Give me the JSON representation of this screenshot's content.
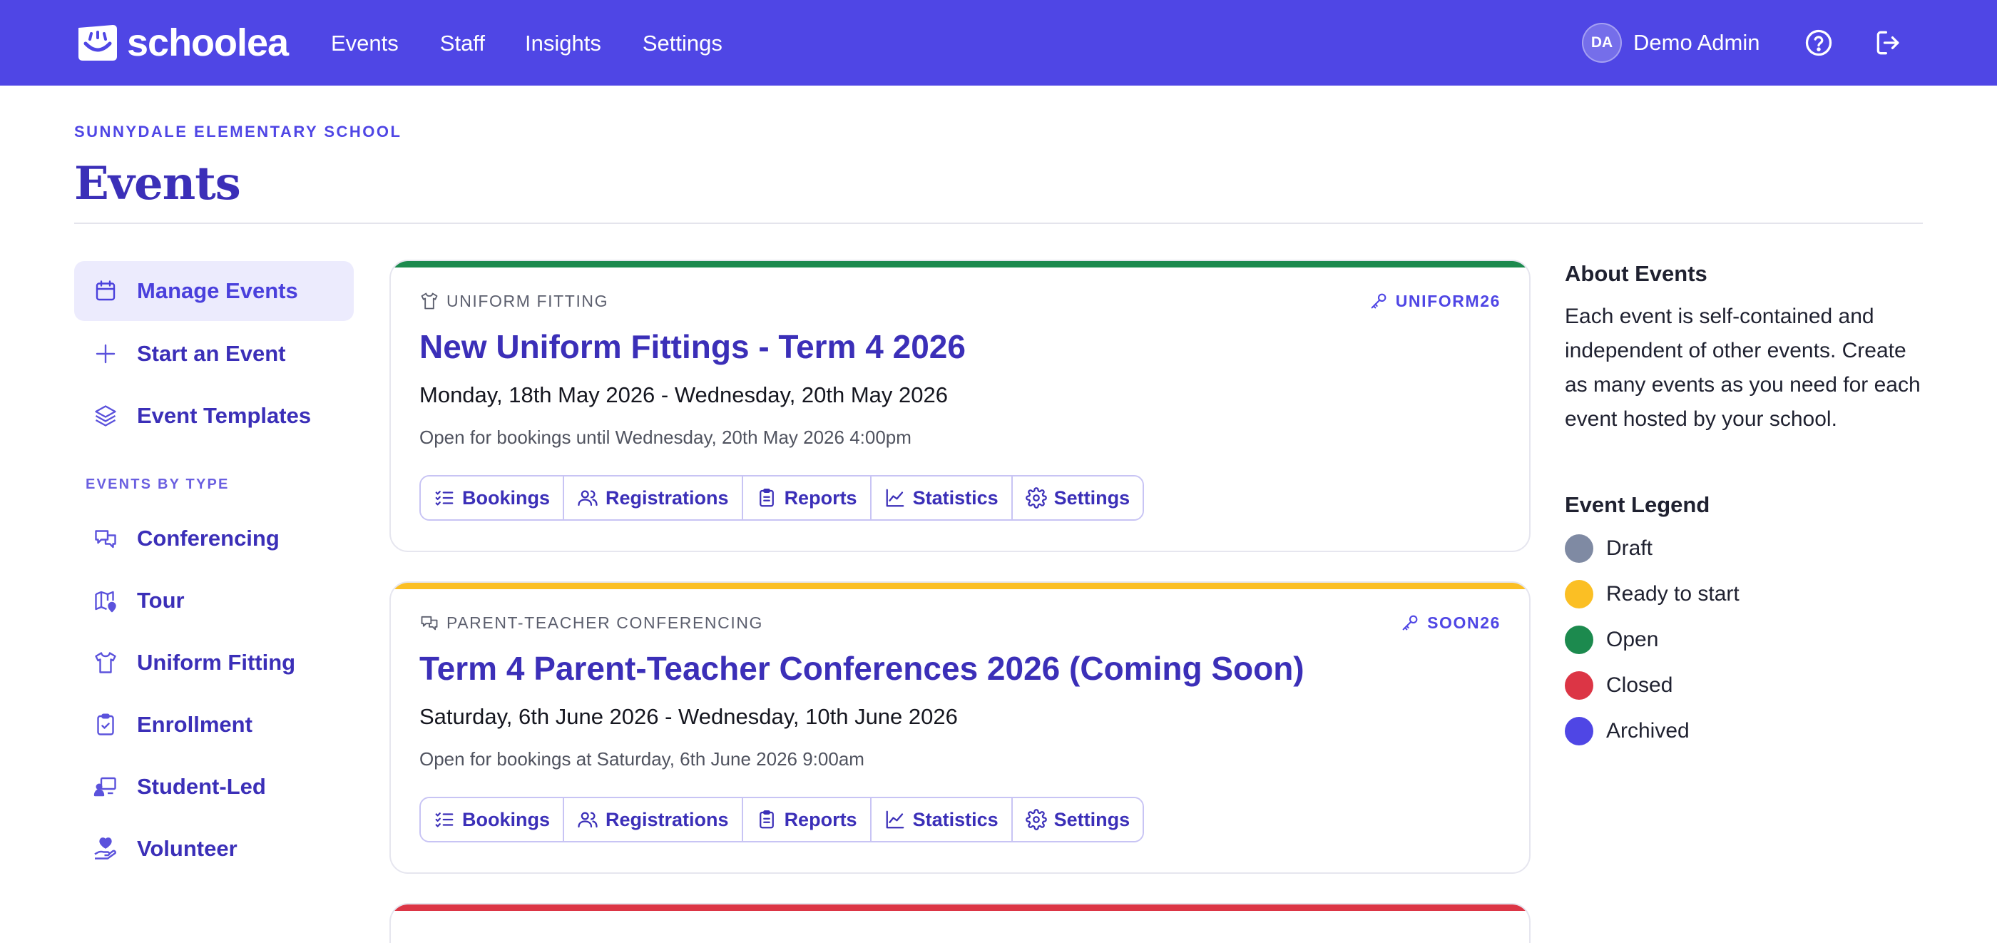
{
  "app": {
    "brand": "schoolea"
  },
  "nav": {
    "links": [
      "Events",
      "Staff",
      "Insights",
      "Settings"
    ],
    "user_initials": "DA",
    "user_name": "Demo Admin"
  },
  "header": {
    "school": "SUNNYDALE ELEMENTARY SCHOOL",
    "title": "Events"
  },
  "sidebar": {
    "primary": [
      {
        "label": "Manage Events",
        "icon": "calendar-icon",
        "active": true
      },
      {
        "label": "Start an Event",
        "icon": "plus-icon"
      },
      {
        "label": "Event Templates",
        "icon": "layers-icon"
      }
    ],
    "section_label": "EVENTS BY TYPE",
    "types": [
      {
        "label": "Conferencing",
        "icon": "chat-bubbles-icon"
      },
      {
        "label": "Tour",
        "icon": "map-pin-icon"
      },
      {
        "label": "Uniform Fitting",
        "icon": "shirt-icon"
      },
      {
        "label": "Enrollment",
        "icon": "clipboard-check-icon"
      },
      {
        "label": "Student-Led",
        "icon": "presentation-icon"
      },
      {
        "label": "Volunteer",
        "icon": "hand-heart-icon"
      }
    ]
  },
  "events": [
    {
      "type": "UNIFORM FITTING",
      "type_icon": "shirt-icon",
      "code": "UNIFORM26",
      "title": "New Uniform Fittings - Term 4 2026",
      "dates": "Monday, 18th May 2026 - Wednesday, 20th May 2026",
      "status_text": "Open for bookings until Wednesday, 20th May 2026 4:00pm",
      "status_color": "#1c8a4e"
    },
    {
      "type": "PARENT-TEACHER CONFERENCING",
      "type_icon": "chat-bubbles-icon",
      "code": "SOON26",
      "title": "Term 4 Parent-Teacher Conferences 2026 (Coming Soon)",
      "dates": "Saturday, 6th June 2026 - Wednesday, 10th June 2026",
      "status_text": "Open for bookings at Saturday, 6th June 2026 9:00am",
      "status_color": "#fbbf24"
    },
    {
      "status_color": "#dc3545"
    }
  ],
  "card_buttons": [
    {
      "label": "Bookings",
      "icon": "list-check-icon"
    },
    {
      "label": "Registrations",
      "icon": "users-icon"
    },
    {
      "label": "Reports",
      "icon": "clipboard-icon"
    },
    {
      "label": "Statistics",
      "icon": "chart-line-icon"
    },
    {
      "label": "Settings",
      "icon": "gear-icon"
    }
  ],
  "about": {
    "title": "About Events",
    "text": "Each event is self-contained and independent of other events. Create as many events as you need for each event hosted by your school."
  },
  "legend": {
    "title": "Event Legend",
    "items": [
      {
        "label": "Draft",
        "color": "#7f8aa3"
      },
      {
        "label": "Ready to start",
        "color": "#fbbf24"
      },
      {
        "label": "Open",
        "color": "#1c8a4e"
      },
      {
        "label": "Closed",
        "color": "#dc3545"
      },
      {
        "label": "Archived",
        "color": "#4f46e5"
      }
    ]
  }
}
